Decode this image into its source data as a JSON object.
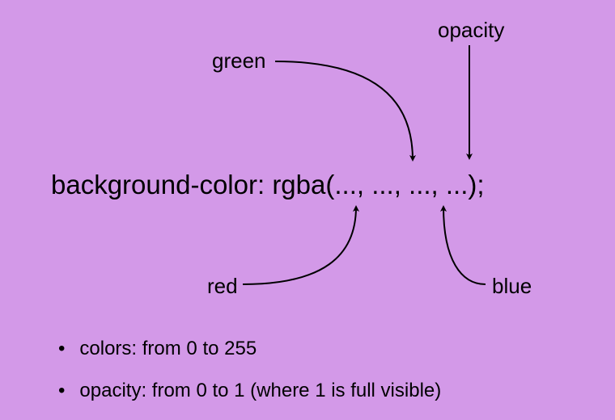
{
  "labels": {
    "green": "green",
    "opacity": "opacity",
    "red": "red",
    "blue": "blue"
  },
  "code": {
    "text": "background-color: rgba(..., ..., ..., ...);"
  },
  "bullets": {
    "item1": "colors: from 0 to 255",
    "item2": "opacity: from 0 to 1 (where 1 is full visible)"
  }
}
